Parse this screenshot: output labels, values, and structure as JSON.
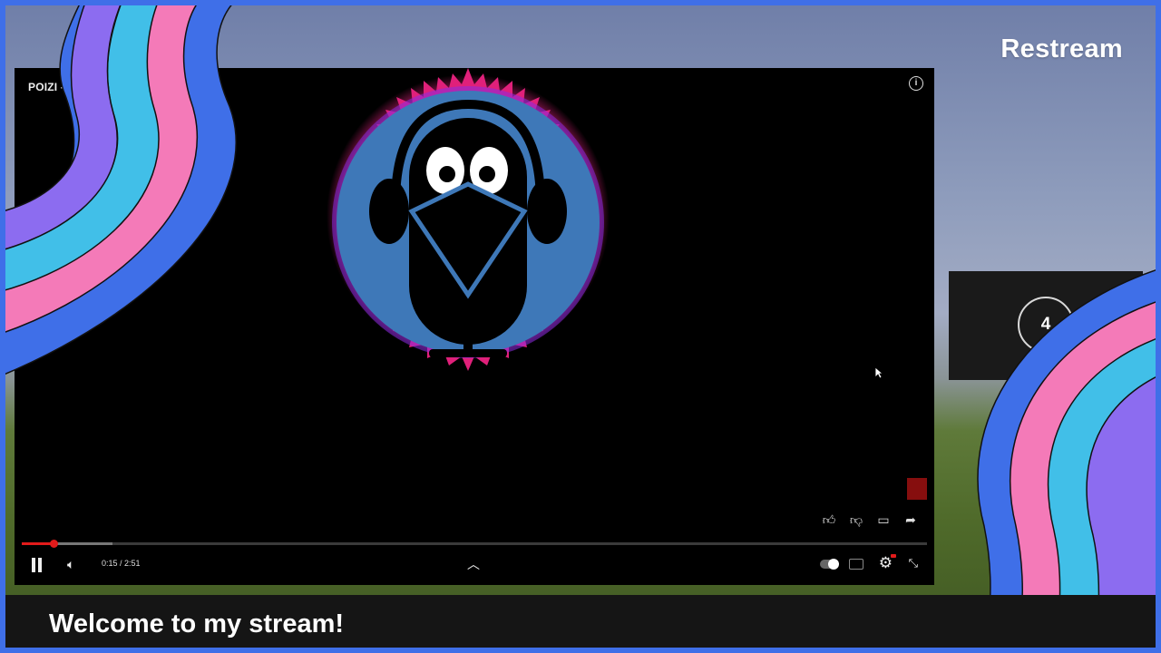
{
  "brand": {
    "name": "Restream"
  },
  "player": {
    "title": "POIZI - K                              ) / COVER",
    "time": "0:15 / 2:51",
    "progress_played": 0.035,
    "progress_buffered": 0.1,
    "icons": {
      "info": "info-icon",
      "like": "thumbs-up-icon",
      "dislike": "thumbs-down-icon",
      "comment": "comment-icon",
      "share": "share-icon",
      "pause": "pause-icon",
      "volume": "volume-icon",
      "chevron": "chevron-up-icon",
      "autoplay": "autoplay-toggle",
      "captions": "captions-icon",
      "settings": "gear-icon",
      "exit_fullscreen": "exit-fullscreen-icon"
    }
  },
  "side_panel": {
    "count": "4"
  },
  "ticker": {
    "message": "Welcome to my stream!"
  },
  "colors": {
    "frame_border": "#3f6fe8",
    "arc_blue": "#3f6fe8",
    "arc_pink": "#f47ab8",
    "arc_cyan": "#41bfe8",
    "arc_purple": "#8c6cf0",
    "progress_red": "#e21b1b",
    "logo_blue": "#3e78b8",
    "logo_glow": "#e0207a"
  }
}
